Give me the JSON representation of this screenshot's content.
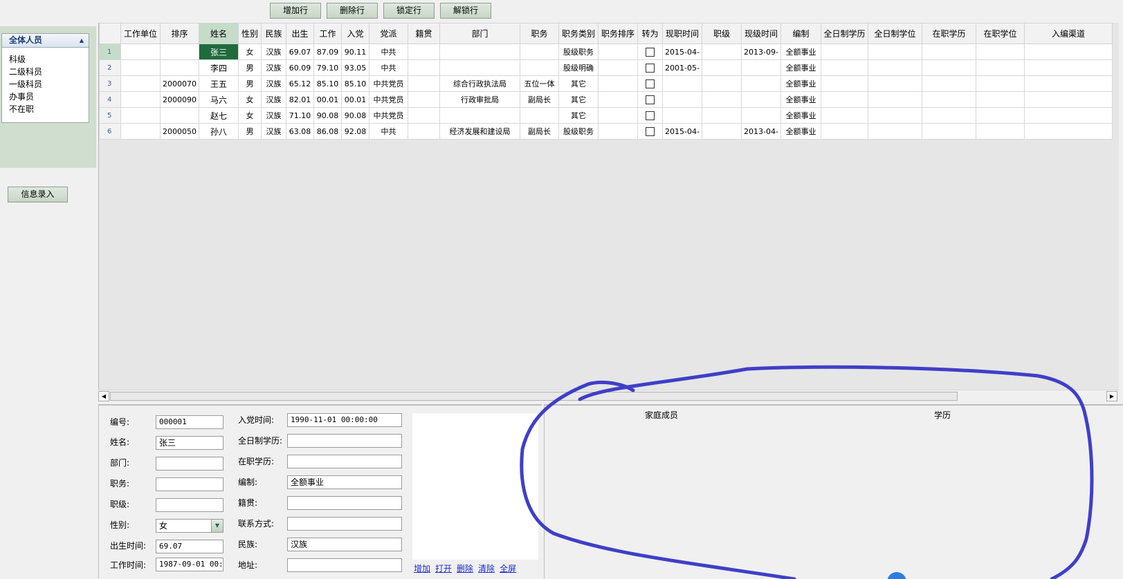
{
  "toolbar": {
    "add_row": "增加行",
    "delete_row": "删除行",
    "lock_row": "锁定行",
    "unlock_row": "解锁行"
  },
  "category_list": {
    "header": "全体人员",
    "items": [
      "科级",
      "二级科员",
      "一级科员",
      "办事员",
      "不在职"
    ]
  },
  "entry_button": "信息录入",
  "grid": {
    "columns": [
      "工作单位",
      "排序",
      "姓名",
      "性别",
      "民族",
      "出生",
      "工作",
      "入党",
      "党派",
      "籍贯",
      "部门",
      "职务",
      "职务类别",
      "职务排序",
      "转为",
      "现职时间",
      "职级",
      "现级时间",
      "编制",
      "全日制学历",
      "全日制学位",
      "在职学历",
      "在职学位",
      "入编渠道"
    ],
    "rows": [
      {
        "num": "1",
        "cells": [
          "",
          "",
          "张三",
          "女",
          "汉族",
          "69.07",
          "87.09",
          "90.11",
          "中共",
          "",
          "",
          "",
          "股级职务",
          "",
          "",
          "2015-04-",
          "",
          "2013-09-",
          "全额事业",
          "",
          "",
          "",
          "",
          ""
        ]
      },
      {
        "num": "2",
        "cells": [
          "",
          "",
          "李四",
          "男",
          "汉族",
          "60.09",
          "79.10",
          "93.05",
          "中共",
          "",
          "",
          "",
          "股级明确",
          "",
          "",
          "2001-05-",
          "",
          "",
          "全额事业",
          "",
          "",
          "",
          "",
          ""
        ]
      },
      {
        "num": "3",
        "cells": [
          "",
          "2000070",
          "王五",
          "男",
          "汉族",
          "65.12",
          "85.10",
          "85.10",
          "中共党员",
          "",
          "综合行政执法局",
          "五位一体",
          "其它",
          "",
          "",
          "",
          "",
          "",
          "全额事业",
          "",
          "",
          "",
          "",
          ""
        ]
      },
      {
        "num": "4",
        "cells": [
          "",
          "2000090",
          "马六",
          "女",
          "汉族",
          "82.01",
          "00.01",
          "00.01",
          "中共党员",
          "",
          "行政审批局",
          "副局长",
          "其它",
          "",
          "",
          "",
          "",
          "",
          "全额事业",
          "",
          "",
          "",
          "",
          ""
        ]
      },
      {
        "num": "5",
        "cells": [
          "",
          "",
          "赵七",
          "女",
          "汉族",
          "71.10",
          "90.08",
          "90.08",
          "中共党员",
          "",
          "",
          "",
          "其它",
          "",
          "",
          "",
          "",
          "",
          "全额事业",
          "",
          "",
          "",
          "",
          ""
        ]
      },
      {
        "num": "6",
        "cells": [
          "",
          "2000050",
          "孙八",
          "男",
          "汉族",
          "63.08",
          "86.08",
          "92.08",
          "中共",
          "",
          "经济发展和建设局",
          "副局长",
          "股级职务",
          "",
          "",
          "2015-04-",
          "",
          "2013-04-",
          "全额事业",
          "",
          "",
          "",
          "",
          ""
        ]
      }
    ]
  },
  "form": {
    "labels": {
      "id": "编号:",
      "name": "姓名:",
      "dept": "部门:",
      "position": "职务:",
      "rank": "职级:",
      "gender": "性别:",
      "birth": "出生时间:",
      "work": "工作时间:",
      "party_time": "入党时间:",
      "ft_edu": "全日制学历:",
      "pt_edu": "在职学历:",
      "staffing": "编制:",
      "origin": "籍贯:",
      "contact": "联系方式:",
      "ethnic": "民族:",
      "address": "地址:"
    },
    "values": {
      "id": "000001",
      "name": "张三",
      "dept": "",
      "position": "",
      "rank": "",
      "gender": "女",
      "birth": "69.07",
      "work": "1987-09-01 00:0",
      "party_time": "1990-11-01 00:00:00",
      "ft_edu": "",
      "pt_edu": "",
      "staffing": "全额事业",
      "origin": "",
      "contact": "",
      "ethnic": "汉族",
      "address": ""
    }
  },
  "photo_links": [
    "增加",
    "打开",
    "删除",
    "清除",
    "全屏"
  ],
  "right_panel": {
    "family_title": "家庭成员",
    "education_title": "学历"
  },
  "colors": {
    "button_bg": "#cfdecf",
    "selected_cell": "#1e6b3c",
    "annotation_stroke": "#3f3fc8",
    "link": "#1a2cc8"
  }
}
